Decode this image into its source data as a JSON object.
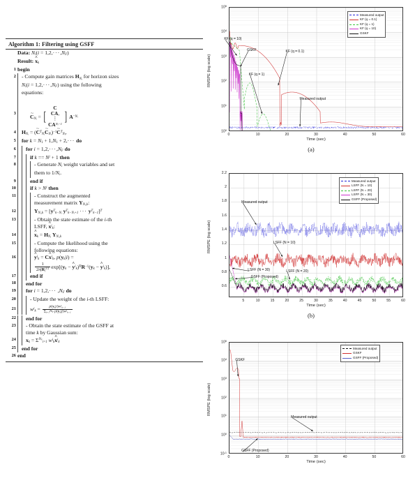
{
  "algorithm": {
    "title": "Algorithm 1: Filtering using GSFF",
    "header_lines": [
      {
        "label": "Data:",
        "text": "N_i(i = 1, 2, ..., N_F)"
      },
      {
        "label": "Result:",
        "text": "x̂_k"
      }
    ],
    "lines": [
      {
        "n": "1",
        "depth": 0,
        "text": "begin"
      },
      {
        "n": "2",
        "depth": 1,
        "text": "- Compute gain matrices H_Ni for horizon sizes N_i(i = 1,2,···,N_F) using the following equations:"
      },
      {
        "n": "3",
        "depth": 1,
        "text": "C̃_Ni = [C; CA; ⋮; CA^(N_i−1)] A^(−N_i)"
      },
      {
        "n": "4",
        "depth": 1,
        "text": "H_Ni = (C̃ᵀ_Ni C̃_Ni)^(−1) C̃ᵀ_Ni,"
      },
      {
        "n": "5",
        "depth": 1,
        "text": "for k = N_1 + 1, N_1 + 2, ··· do"
      },
      {
        "n": "6",
        "depth": 2,
        "text": "for i = 1, 2, ···, N_F do"
      },
      {
        "n": "7",
        "depth": 3,
        "text": "if k == N^i + 1 then"
      },
      {
        "n": "8",
        "depth": 4,
        "text": "- Generate N_i weight variables and set them to 1/N_i."
      },
      {
        "n": "9",
        "depth": 3,
        "text": "end if"
      },
      {
        "n": "10",
        "depth": 3,
        "text": "if k > N^i then"
      },
      {
        "n": "11",
        "depth": 4,
        "text": "- Construct the augmented measurement matrix Y_Ni,k:"
      },
      {
        "n": "12",
        "depth": 4,
        "text": "Y_Ni,k = [yᵀ_k−Ni  yᵀ_k−Ni+1  ···  yᵀ_k−1]ᵀ"
      },
      {
        "n": "13",
        "depth": 4,
        "text": "- Obtain the state estimate of the i-th LSFF, x̂ⁱ_k:"
      },
      {
        "n": "14",
        "depth": 4,
        "text": "x̂_k = H_Ni Y_Ni,k"
      },
      {
        "n": "15",
        "depth": 4,
        "text": "- Compute the likelihood using the following equations:"
      },
      {
        "n": "16",
        "depth": 4,
        "text": "ŷⁱ_k = Cx̂ⁱ_k, p(y_k|i) = 1/(2π|R|^(1/2)) exp[(y_k − ŷⁱ_k)ᵀ R^(−1) (y_k − ŷⁱ_k)],"
      },
      {
        "n": "17",
        "depth": 3,
        "text": "end if"
      },
      {
        "n": "18",
        "depth": 2,
        "text": "end for"
      },
      {
        "n": "19",
        "depth": 2,
        "text": "for i = 1, 2, ···, N_F do"
      },
      {
        "n": "20",
        "depth": 3,
        "text": "- Update the weight of the i-th LSFF:"
      },
      {
        "n": "21",
        "depth": 3,
        "text": "wⁱ_k = p(y_k|i)wⁱ_k−1 / Σ_{j=1..N_F} p(y_k|j)wʲ_k−1"
      },
      {
        "n": "22",
        "depth": 2,
        "text": "end for"
      },
      {
        "n": "23",
        "depth": 2,
        "text": "- Obtain the state estimate of the GSFF at time k by Gaussian sum:"
      },
      {
        "n": "24",
        "depth": 2,
        "text": "x_k = Σ^{N_F}_{i=1} wⁱ_k x̂ⁱ_k"
      },
      {
        "n": "25",
        "depth": 1,
        "text": "end for"
      },
      {
        "n": "26",
        "depth": 0,
        "text": "end"
      }
    ]
  },
  "figures": [
    {
      "caption": "(a)",
      "chart_data": {
        "type": "line",
        "title": "",
        "xlabel": "Time (sec)",
        "ylabel": "RMSPE (log scale)",
        "xlim": [
          0,
          60
        ],
        "ylim": [
          1,
          100000
        ],
        "yscale": "log",
        "xticks": [
          0,
          10,
          20,
          30,
          40,
          50,
          60
        ],
        "yticks": [
          "10^0",
          "10^1",
          "10^2",
          "10^3",
          "10^4",
          "10^5"
        ],
        "grid": true,
        "legend_position": "top-right",
        "legend": [
          "Measured output",
          "KF (q = 0.1)",
          "KF (q = 1)",
          "KF (q = 10)",
          "GSKF"
        ],
        "colors": [
          "#2323d8",
          "#d03030",
          "#3fc43f",
          "#cc33cc",
          "#101010"
        ],
        "annotations": [
          {
            "text": "KF (q = 10)",
            "x": 8.0,
            "y": 2800
          },
          {
            "text": "GSKF",
            "x": 12.5,
            "y": 1150
          },
          {
            "text": "KF (q = 0.1)",
            "x": 21.0,
            "y": 900
          },
          {
            "text": "KF (q = 1)",
            "x": 16.5,
            "y": 120
          },
          {
            "text": "Measured output",
            "x": 33.0,
            "y": 11
          }
        ],
        "series": [
          {
            "name": "Measured output",
            "color": "#2323d8",
            "style": "dashdot",
            "steady": 1.5
          },
          {
            "name": "KF (q = 0.1)",
            "color": "#d03030",
            "style": "solid",
            "steady": 1.6
          },
          {
            "name": "KF (q = 1)",
            "color": "#3fc43f",
            "style": "dashed",
            "steady": 0.62
          },
          {
            "name": "KF (q = 10)",
            "color": "#cc33cc",
            "style": "solid-dotmark",
            "steady": 0.8
          },
          {
            "name": "GSKF",
            "color": "#101010",
            "style": "solid",
            "steady": 0.8
          }
        ]
      }
    },
    {
      "caption": "(b)",
      "chart_data": {
        "type": "line",
        "title": "",
        "xlabel": "Time (sec)",
        "ylabel": "RMSPE (log scale)",
        "xlim": [
          0,
          60
        ],
        "ylim": [
          0.45,
          2.2
        ],
        "yscale": "linear",
        "xticks": [
          5,
          10,
          15,
          20,
          25,
          30,
          35,
          40,
          45,
          50,
          55,
          60
        ],
        "yticks": [
          "0.6",
          "0.8",
          "1",
          "1.2",
          "1.4",
          "1.6",
          "1.8",
          "2",
          "2.2"
        ],
        "grid": true,
        "legend_position": "top-right",
        "legend": [
          "Measured output",
          "LSFF (N = 10)",
          "LSFF (N = 20)",
          "LSFF (N = 30)",
          "GSFF (Proposed)"
        ],
        "colors": [
          "#2323d8",
          "#d03030",
          "#3fc43f",
          "#cc33cc",
          "#101010"
        ],
        "annotations": [
          {
            "text": "Measured output",
            "x": 13.0,
            "y": 1.72
          },
          {
            "text": "LSFF (N = 10)",
            "x": 22.5,
            "y": 1.16
          },
          {
            "text": "LSFF (N = 30)",
            "x": 7.5,
            "y": 0.82
          },
          {
            "text": "GSFF (Proposed)",
            "x": 9.5,
            "y": 0.73
          },
          {
            "text": "LSFF (N = 20)",
            "x": 25.5,
            "y": 0.755
          }
        ],
        "series": [
          {
            "name": "Measured output",
            "color": "#2323d8",
            "style": "dotted",
            "mean": 1.41
          },
          {
            "name": "LSFF (N = 10)",
            "color": "#d03030",
            "style": "solid",
            "mean": 0.98
          },
          {
            "name": "LSFF (N = 20)",
            "color": "#3fc43f",
            "style": "dashed",
            "mean": 0.69
          },
          {
            "name": "LSFF (N = 30)",
            "color": "#cc33cc",
            "style": "solid",
            "mean": 0.585
          },
          {
            "name": "GSFF (Proposed)",
            "color": "#101010",
            "style": "solid",
            "mean": 0.59
          }
        ]
      }
    },
    {
      "caption": "",
      "chart_data": {
        "type": "line",
        "title": "",
        "xlabel": "Time (sec)",
        "ylabel": "RMSPE (log scale)",
        "xlim": [
          0,
          60
        ],
        "ylim": [
          0.1,
          100000
        ],
        "yscale": "log",
        "xticks": [
          0,
          10,
          20,
          30,
          40,
          50,
          60
        ],
        "yticks": [
          "10^-1",
          "10^0",
          "10^1",
          "10^2",
          "10^3",
          "10^4",
          "10^5"
        ],
        "grid": true,
        "legend_position": "top-right",
        "legend": [
          "Measured output",
          "GSKF",
          "GSFF (Proposed)"
        ],
        "colors": [
          "#101010",
          "#d03030",
          "#5560c8"
        ],
        "annotations": [
          {
            "text": "GSKF",
            "x": 8.5,
            "y": 6000
          },
          {
            "text": "Measured output",
            "x": 31.0,
            "y": 5.0
          },
          {
            "text": "GSFF (Proposed)",
            "x": 13.0,
            "y": 0.25
          }
        ],
        "series": [
          {
            "name": "Measured output",
            "color": "#101010",
            "style": "dashed",
            "steady": 1.5
          },
          {
            "name": "GSKF",
            "color": "#d03030",
            "style": "solid",
            "steady": 0.82
          },
          {
            "name": "GSFF (Proposed)",
            "color": "#5560c8",
            "style": "solid",
            "steady": 0.65
          }
        ]
      }
    }
  ]
}
